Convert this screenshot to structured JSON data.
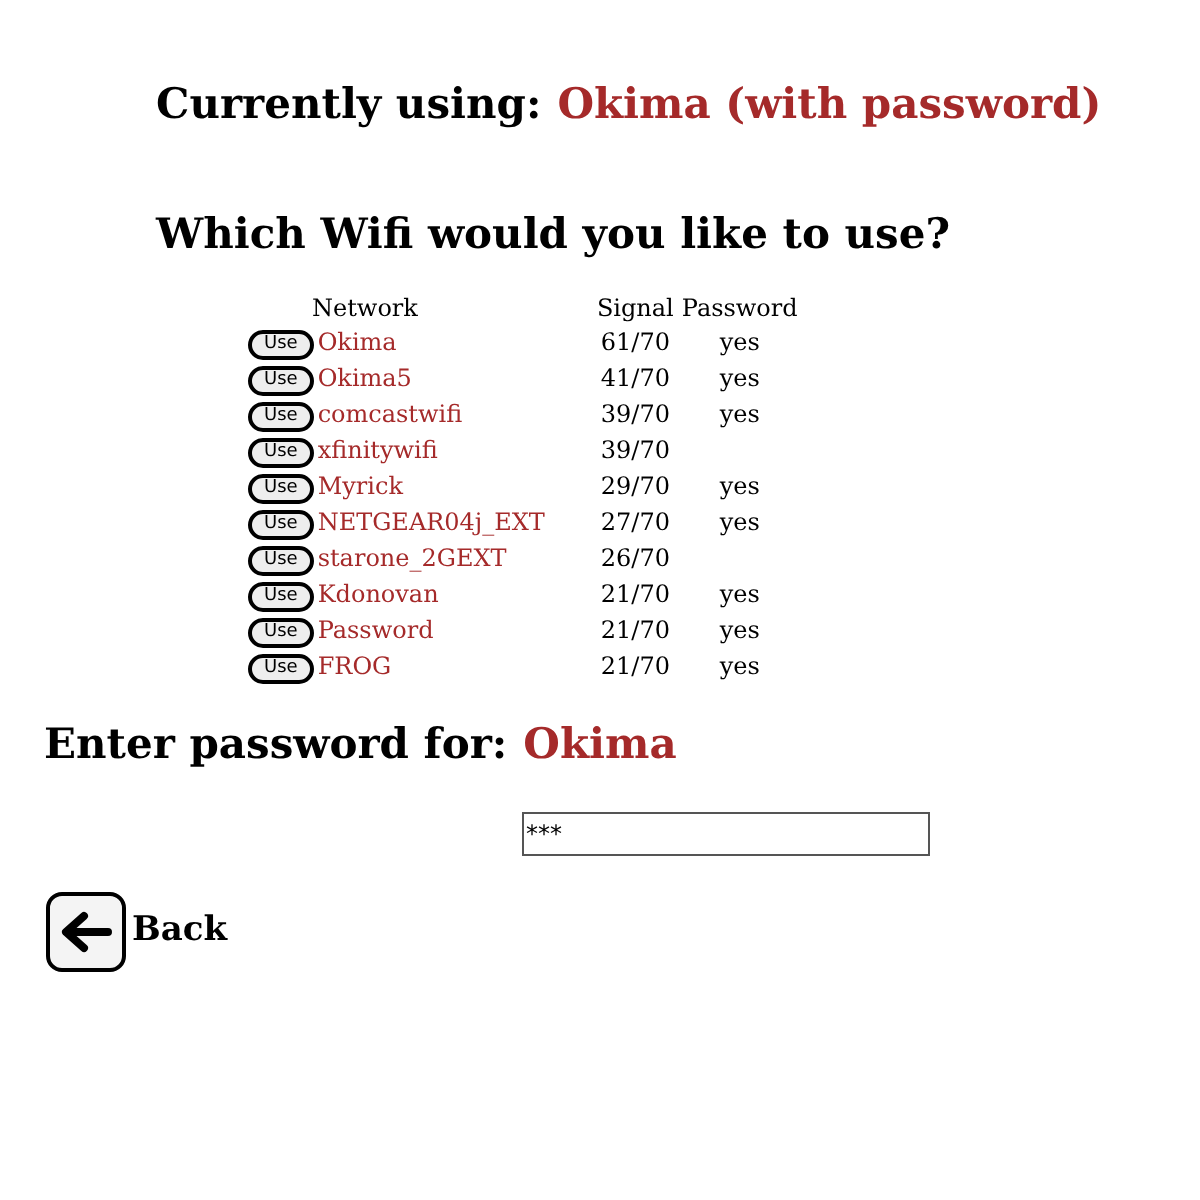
{
  "current": {
    "label": "Currently using:",
    "network": "Okima (with password)"
  },
  "heading": "Which Wifi would you like to use?",
  "table": {
    "columns": [
      "Network",
      "Signal",
      "Password"
    ],
    "rows": [
      {
        "button": "Use",
        "network": "Okima",
        "signal": "61/70",
        "password": "yes"
      },
      {
        "button": "Use",
        "network": "Okima5",
        "signal": "41/70",
        "password": "yes"
      },
      {
        "button": "Use",
        "network": "comcastwifi",
        "signal": "39/70",
        "password": "yes"
      },
      {
        "button": "Use",
        "network": "xfinitywifi",
        "signal": "39/70"
      },
      {
        "button": "Use",
        "network": "Myrick",
        "signal": "29/70",
        "password": "yes"
      },
      {
        "button": "Use",
        "network": "NETGEAR04j_EXT",
        "signal": "27/70",
        "password": "yes"
      },
      {
        "button": "Use",
        "network": "starone_2GEXT",
        "signal": "26/70"
      },
      {
        "button": "Use",
        "network": "Kdonovan",
        "signal": "21/70",
        "password": "yes"
      },
      {
        "button": "Use",
        "network": "Password",
        "signal": "21/70",
        "password": "yes"
      },
      {
        "button": "Use",
        "network": "FROG",
        "signal": "21/70",
        "password": "yes"
      }
    ]
  },
  "password_prompt": {
    "label": "Enter password for:",
    "network": "Okima"
  },
  "password_field": {
    "value": "***"
  },
  "back_button": {
    "label": "Back"
  }
}
